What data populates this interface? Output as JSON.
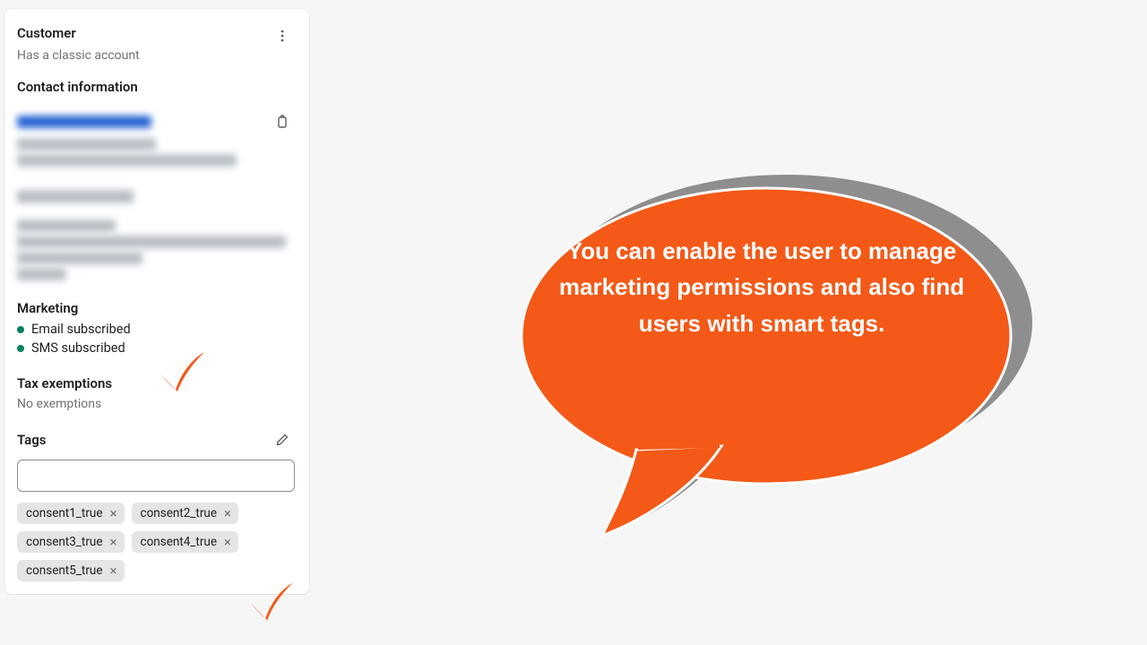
{
  "card": {
    "customer_heading": "Customer",
    "customer_sub": "Has a classic account",
    "contact_heading": "Contact information",
    "marketing_heading": "Marketing",
    "marketing_email": "Email subscribed",
    "marketing_sms": "SMS subscribed",
    "tax_heading": "Tax exemptions",
    "tax_value": "No exemptions",
    "tags_heading": "Tags"
  },
  "tags": {
    "list": [
      {
        "label": "consent1_true"
      },
      {
        "label": "consent2_true"
      },
      {
        "label": "consent3_true"
      },
      {
        "label": "consent4_true"
      },
      {
        "label": "consent5_true"
      }
    ]
  },
  "bubble": {
    "text": "You can enable the user to manage marketing permissions and also find users with smart tags."
  },
  "colors": {
    "accent": "#f45917"
  }
}
